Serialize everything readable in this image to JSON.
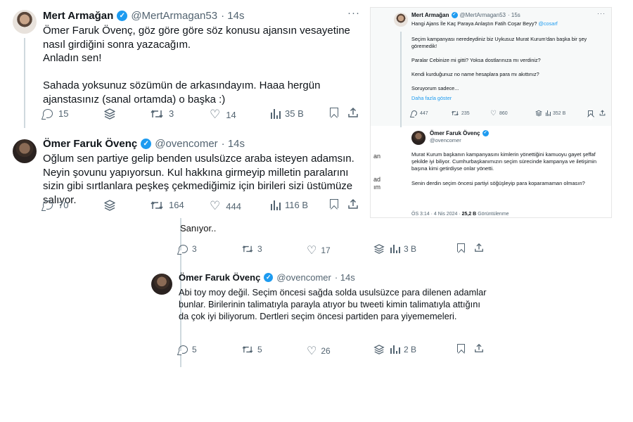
{
  "panel1": {
    "tweet1": {
      "name": "Mert Armağan",
      "handle": "@MertArmagan53",
      "time": "· 14s",
      "text": "Ömer Faruk Övenç, göz göre göre söz konusu ajansın vesayetine nasıl girdiğini sonra yazacağım.\nAnladın sen!\n\nSahada yoksunuz sözümün de arkasındayım. Haaa hergün ajanstasınız (sanal ortamda) o başka :)",
      "replies": "15",
      "retweets": "3",
      "likes": "14",
      "views": "35 B"
    },
    "tweet2": {
      "name": "Ömer Faruk Övenç",
      "handle": "@ovencomer",
      "time": "· 14s",
      "text": "Oğlum sen partiye gelip benden usulsüzce araba isteyen adamsın. Neyin şovunu yapıyorsun. Kul hakkına girmeyip milletin paralarını sizin gibi sırtlanlara peşkeş çekmediğimiz için birileri sizi üstümüze salıyor.",
      "replies": "70",
      "retweets": "164",
      "likes": "444",
      "views": "116 B"
    }
  },
  "panel2": {
    "tweet1": {
      "name": "Mert Armağan",
      "handle": "@MertArmagan53",
      "time": "· 15s",
      "line1_text": "Hangi Ajans İle Kaç Paraya Anlaştın Fatih Coşar Beyy?",
      "line1_mention": "@cosarf",
      "text": "Seçim kampanyası neredeydiniz biz Uykusuz Murat Kurum'dan başka bir şey göremedik!\n\nParalar Cebinize mi gitti? Yoksa dostlarınıza mı verdiniz?\n\nKendi kurduğunuz no name hesaplara para mı akıttınız?\n\nSoruyorum sadece...",
      "show_more": "Daha fazla göster",
      "replies": "447",
      "retweets": "235",
      "likes": "860",
      "views": "352 B"
    },
    "tweet2": {
      "name": "Ömer Faruk Övenç",
      "handle": "@ovencomer",
      "text": "Murat Kurum başkanın kampanyasını kimlerin yönettiğini kamuoyu gayet şeffaf şekilde iyi biliyor. Cumhurbaşkanımızın seçim sürecinde kampanya ve iletişimin başına kimi getirdiyse onlar yönetti.\n\nSenin derdin seçim öncesi partiyi söğüşleyip para koparamaman olmasın?",
      "time": "ÖS 3:14 · 4 Nis 2024 ·",
      "views_count": "25,2 B",
      "views_label": "Görüntülenme"
    },
    "clipped_left_text": "an\n\n\nad\nım"
  },
  "panel3": {
    "prev_text": "Sanıyor..",
    "prev_replies": "3",
    "prev_retweets": "3",
    "prev_likes": "17",
    "prev_views": "3 B",
    "tweet": {
      "name": "Ömer Faruk Övenç",
      "handle": "@ovencomer",
      "time": "· 14s",
      "text": "Abi toy moy değil. Seçim öncesi sağda solda usulsüzce para dilenen adamlar bunlar. Birilerinin talimatıyla parayla atıyor bu tweeti kimin talimatıyla attığını da çok iyi biliyorum. Dertleri seçim öncesi partiden para yiyememeleri.",
      "replies": "5",
      "retweets": "5",
      "likes": "26",
      "views": "2 B"
    }
  },
  "icons": {
    "reply": "reply-icon",
    "retweet": "retweet-icon",
    "like": "heart-icon",
    "views": "views-icon",
    "grok": "layers-icon",
    "bookmark": "bookmark-icon",
    "share": "share-icon",
    "verified": "verified-badge-icon",
    "more": "more-options-icon"
  },
  "colors": {
    "accent": "#1d9bf0",
    "text": "#0f1419",
    "secondary": "#536471"
  }
}
